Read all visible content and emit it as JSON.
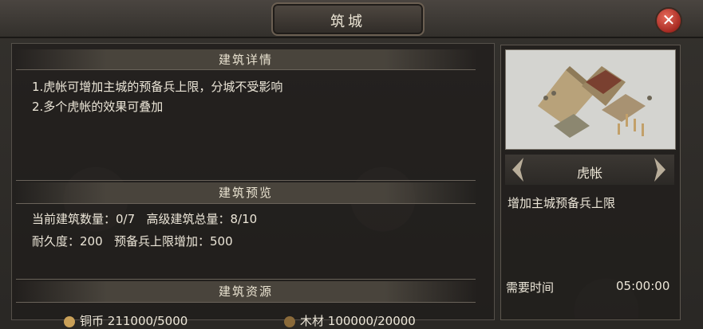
{
  "window": {
    "title": "筑城",
    "close_icon": "close-icon",
    "accent": "#b33025"
  },
  "details": {
    "header": "建筑详情",
    "lines": [
      "1.虎帐可增加主城的预备兵上限，分城不受影响",
      "2.多个虎帐的效果可叠加"
    ]
  },
  "preview": {
    "header": "建筑预览",
    "current_count_label": "当前建筑数量：",
    "current_count": "0/7",
    "senior_total_label": "高级建筑总量：",
    "senior_total": "8/10",
    "durability_label": "耐久度：",
    "durability": "200",
    "reserve_label": "预备兵上限增加：",
    "reserve": "500"
  },
  "resources": {
    "header": "建筑资源",
    "items": [
      {
        "label": "铜币",
        "value": "211000/5000",
        "icon": "coin-icon"
      },
      {
        "label": "木材",
        "value": "100000/20000",
        "icon": "wood-icon"
      }
    ]
  },
  "building": {
    "name": "虎帐",
    "description": "增加主城预备兵上限",
    "time_label": "需要时间",
    "time_value": "05:00:00",
    "image_icon": "army-camp-icon"
  }
}
